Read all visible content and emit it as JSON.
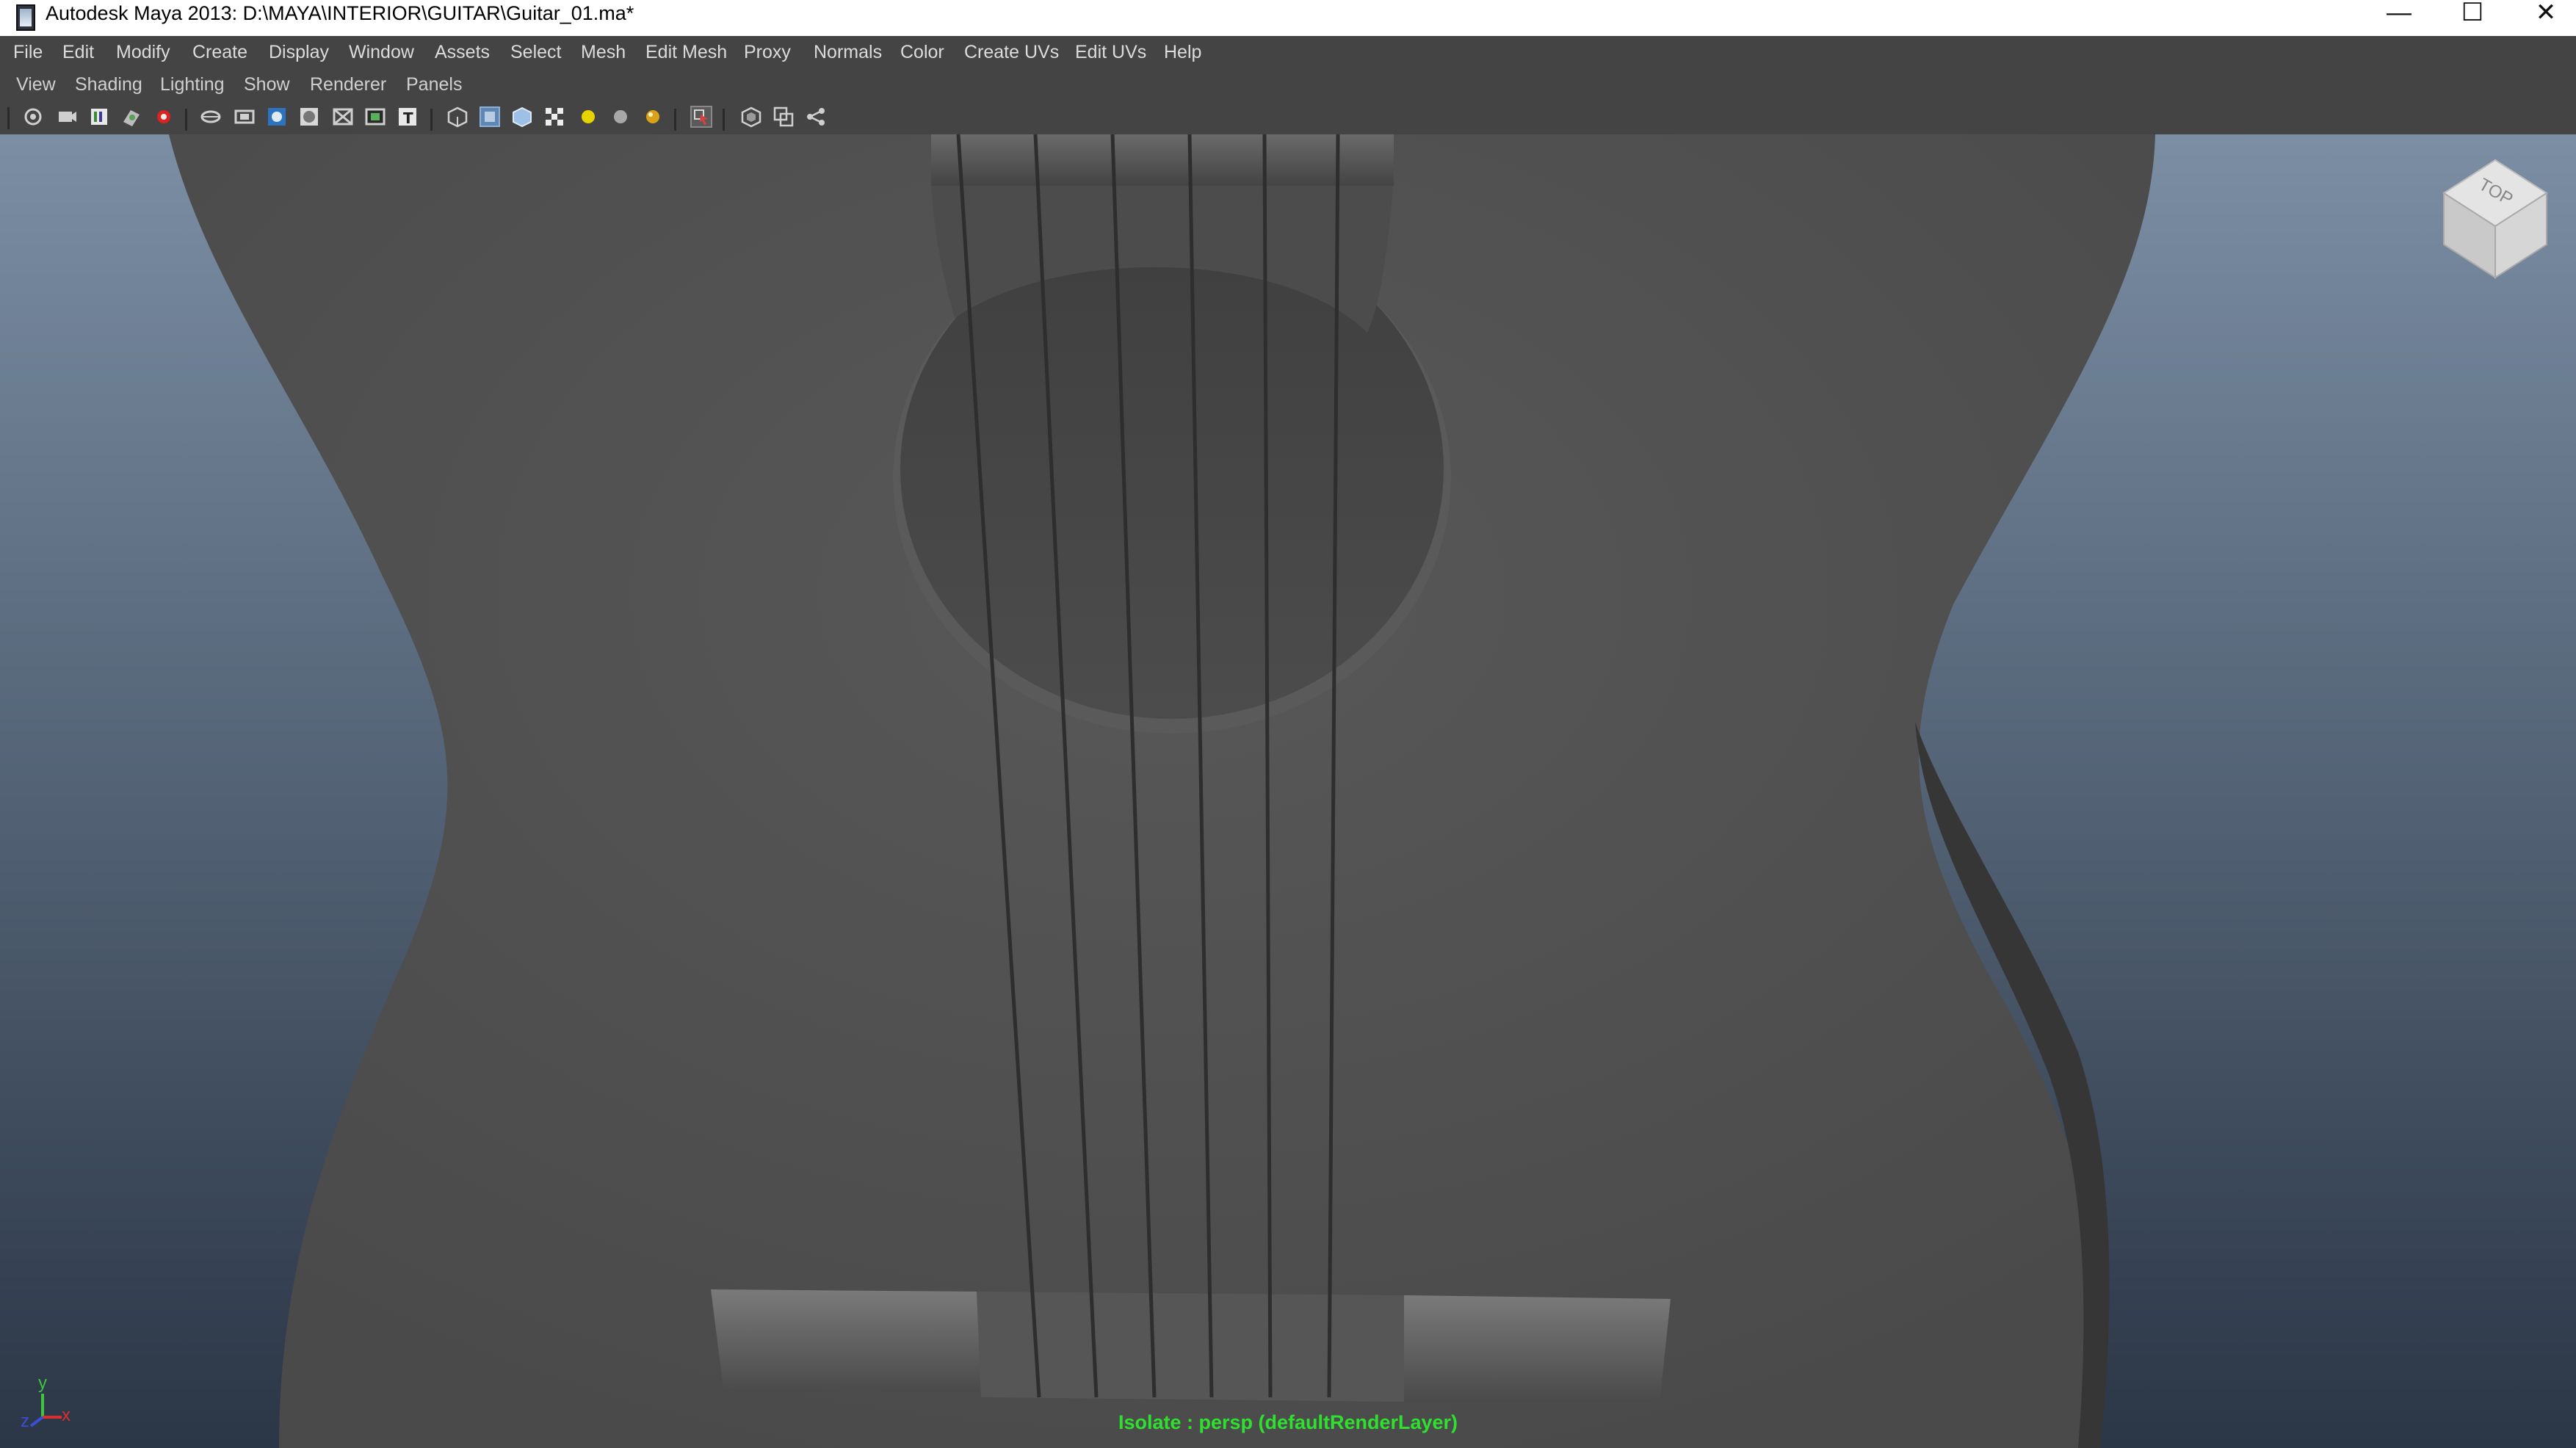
{
  "window": {
    "title": "Autodesk Maya 2013: D:\\MAYA\\INTERIOR\\GUITAR\\Guitar_01.ma*",
    "minimize_glyph": "—",
    "maximize_glyph": "☐",
    "close_glyph": "✕"
  },
  "menubar": {
    "items": [
      "File",
      "Edit",
      "Modify",
      "Create",
      "Display",
      "Window",
      "Assets",
      "Select",
      "Mesh",
      "Edit Mesh",
      "Proxy",
      "Normals",
      "Color",
      "Create UVs",
      "Edit UVs",
      "Help"
    ]
  },
  "panel_menu": {
    "items": [
      "View",
      "Shading",
      "Lighting",
      "Show",
      "Renderer",
      "Panels"
    ]
  },
  "toolbar": {
    "icons": [
      "select-camera-icon",
      "camera-attributes-icon",
      "bookmarks-icon",
      "image-plane-icon",
      "2d-pan-zoom-icon",
      "grid-icon",
      "film-gate-icon",
      "resolution-gate-icon",
      "gate-mask-icon",
      "field-chart-icon",
      "safe-action-icon",
      "safe-title-icon",
      "wireframe-icon",
      "smooth-shade-icon",
      "default-material-icon",
      "textured-icon",
      "use-all-lights-icon",
      "shadows-icon",
      "high-quality-icon",
      "isolate-select-icon",
      "xray-icon",
      "xray-joints-icon",
      "ssao-icon"
    ]
  },
  "viewport": {
    "status_text": "Isolate : persp (defaultRenderLayer)",
    "viewcube_label": "TOP",
    "axis_labels": {
      "y": "y",
      "x": "x",
      "z": "z"
    },
    "colors": {
      "background_top": "#7b8ea4",
      "background_bottom": "#2b3646",
      "mesh": "#515151",
      "status": "#2fe02f"
    }
  }
}
